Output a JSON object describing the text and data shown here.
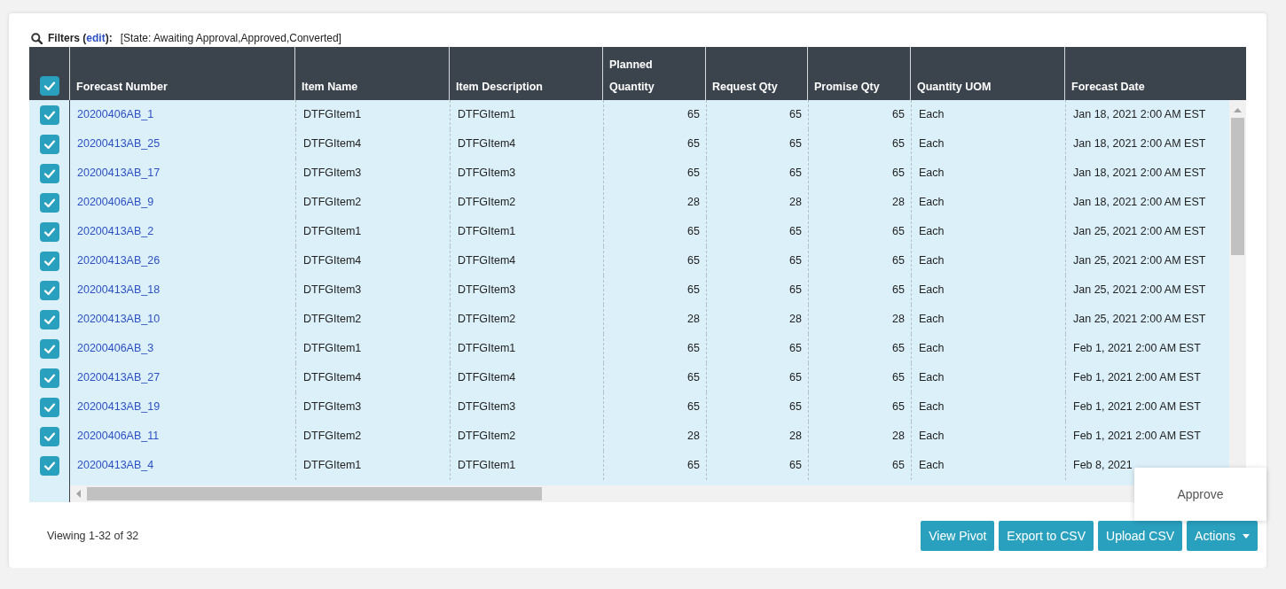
{
  "filters": {
    "prefix": "Filters (",
    "link": "edit",
    "suffix": "):",
    "criteria": "[State: Awaiting Approval,Approved,Converted]"
  },
  "table": {
    "select_all": {
      "checked": true
    },
    "columns": [
      {
        "label": "Forecast Number",
        "kind": "link"
      },
      {
        "label": "Item Name",
        "kind": "text"
      },
      {
        "label": "Item Description",
        "kind": "text"
      },
      {
        "label": "Planned Quantity",
        "kind": "number"
      },
      {
        "label": "Request Qty",
        "kind": "number"
      },
      {
        "label": "Promise Qty",
        "kind": "number"
      },
      {
        "label": "Quantity UOM",
        "kind": "text"
      },
      {
        "label": "Forecast Date",
        "kind": "text"
      }
    ],
    "rows": [
      {
        "checked": true,
        "cells": [
          "20200406AB_1",
          "DTFGItem1",
          "DTFGItem1",
          "65",
          "65",
          "65",
          "Each",
          "Jan 18, 2021 2:00 AM EST"
        ]
      },
      {
        "checked": true,
        "cells": [
          "20200413AB_25",
          "DTFGItem4",
          "DTFGItem4",
          "65",
          "65",
          "65",
          "Each",
          "Jan 18, 2021 2:00 AM EST"
        ]
      },
      {
        "checked": true,
        "cells": [
          "20200413AB_17",
          "DTFGItem3",
          "DTFGItem3",
          "65",
          "65",
          "65",
          "Each",
          "Jan 18, 2021 2:00 AM EST"
        ]
      },
      {
        "checked": true,
        "cells": [
          "20200406AB_9",
          "DTFGItem2",
          "DTFGItem2",
          "28",
          "28",
          "28",
          "Each",
          "Jan 18, 2021 2:00 AM EST"
        ]
      },
      {
        "checked": true,
        "cells": [
          "20200413AB_2",
          "DTFGItem1",
          "DTFGItem1",
          "65",
          "65",
          "65",
          "Each",
          "Jan 25, 2021 2:00 AM EST"
        ]
      },
      {
        "checked": true,
        "cells": [
          "20200413AB_26",
          "DTFGItem4",
          "DTFGItem4",
          "65",
          "65",
          "65",
          "Each",
          "Jan 25, 2021 2:00 AM EST"
        ]
      },
      {
        "checked": true,
        "cells": [
          "20200413AB_18",
          "DTFGItem3",
          "DTFGItem3",
          "65",
          "65",
          "65",
          "Each",
          "Jan 25, 2021 2:00 AM EST"
        ]
      },
      {
        "checked": true,
        "cells": [
          "20200413AB_10",
          "DTFGItem2",
          "DTFGItem2",
          "28",
          "28",
          "28",
          "Each",
          "Jan 25, 2021 2:00 AM EST"
        ]
      },
      {
        "checked": true,
        "cells": [
          "20200406AB_3",
          "DTFGItem1",
          "DTFGItem1",
          "65",
          "65",
          "65",
          "Each",
          "Feb 1, 2021 2:00 AM EST"
        ]
      },
      {
        "checked": true,
        "cells": [
          "20200413AB_27",
          "DTFGItem4",
          "DTFGItem4",
          "65",
          "65",
          "65",
          "Each",
          "Feb 1, 2021 2:00 AM EST"
        ]
      },
      {
        "checked": true,
        "cells": [
          "20200413AB_19",
          "DTFGItem3",
          "DTFGItem3",
          "65",
          "65",
          "65",
          "Each",
          "Feb 1, 2021 2:00 AM EST"
        ]
      },
      {
        "checked": true,
        "cells": [
          "20200406AB_11",
          "DTFGItem2",
          "DTFGItem2",
          "28",
          "28",
          "28",
          "Each",
          "Feb 1, 2021 2:00 AM EST"
        ]
      },
      {
        "checked": true,
        "cells": [
          "20200413AB_4",
          "DTFGItem1",
          "DTFGItem1",
          "65",
          "65",
          "65",
          "Each",
          "Feb 8, 2021"
        ]
      }
    ]
  },
  "footer": {
    "viewing": "Viewing 1-32 of 32",
    "buttons": [
      {
        "label": "View Pivot",
        "kind": "button"
      },
      {
        "label": "Export to CSV",
        "kind": "button"
      },
      {
        "label": "Upload CSV",
        "kind": "button"
      },
      {
        "label": "Actions",
        "kind": "dropdown",
        "expanded": true,
        "menu": [
          {
            "label": "Approve"
          }
        ]
      }
    ]
  }
}
